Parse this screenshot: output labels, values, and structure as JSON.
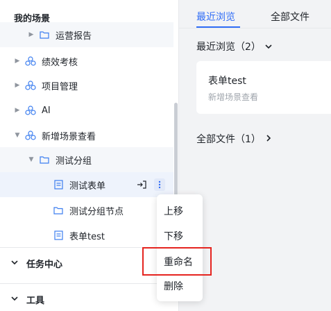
{
  "sidebar": {
    "section_title": "我的场景",
    "items": [
      {
        "label": "运营报告",
        "icon": "folder-icon"
      },
      {
        "label": "绩效考核",
        "icon": "scene-icon"
      },
      {
        "label": "项目管理",
        "icon": "scene-icon"
      },
      {
        "label": "AI",
        "icon": "scene-icon"
      },
      {
        "label": "新增场景查看",
        "icon": "scene-icon"
      },
      {
        "label": "测试分组",
        "icon": "folder-icon"
      },
      {
        "label": "测试表单",
        "icon": "form-icon"
      },
      {
        "label": "测试分组节点",
        "icon": "folder-icon"
      },
      {
        "label": "表单test",
        "icon": "form-icon"
      }
    ],
    "groups": [
      {
        "label": "任务中心"
      },
      {
        "label": "工具"
      }
    ]
  },
  "main": {
    "tabs": [
      {
        "label": "最近浏览",
        "active": true
      },
      {
        "label": "全部文件",
        "active": false
      }
    ],
    "recent": {
      "label": "最近浏览（2）"
    },
    "card": {
      "title": "表单test",
      "subtitle": "新增场景查看"
    },
    "all_files": {
      "label": "全部文件（1）"
    }
  },
  "context_menu": {
    "items": [
      {
        "label": "上移"
      },
      {
        "label": "下移"
      },
      {
        "label": "重命名",
        "highlighted": true
      },
      {
        "label": "删除"
      }
    ]
  },
  "colors": {
    "accent": "#2f6cf6",
    "highlight_border": "#e5241f",
    "selected_row": "#eef3fc"
  }
}
